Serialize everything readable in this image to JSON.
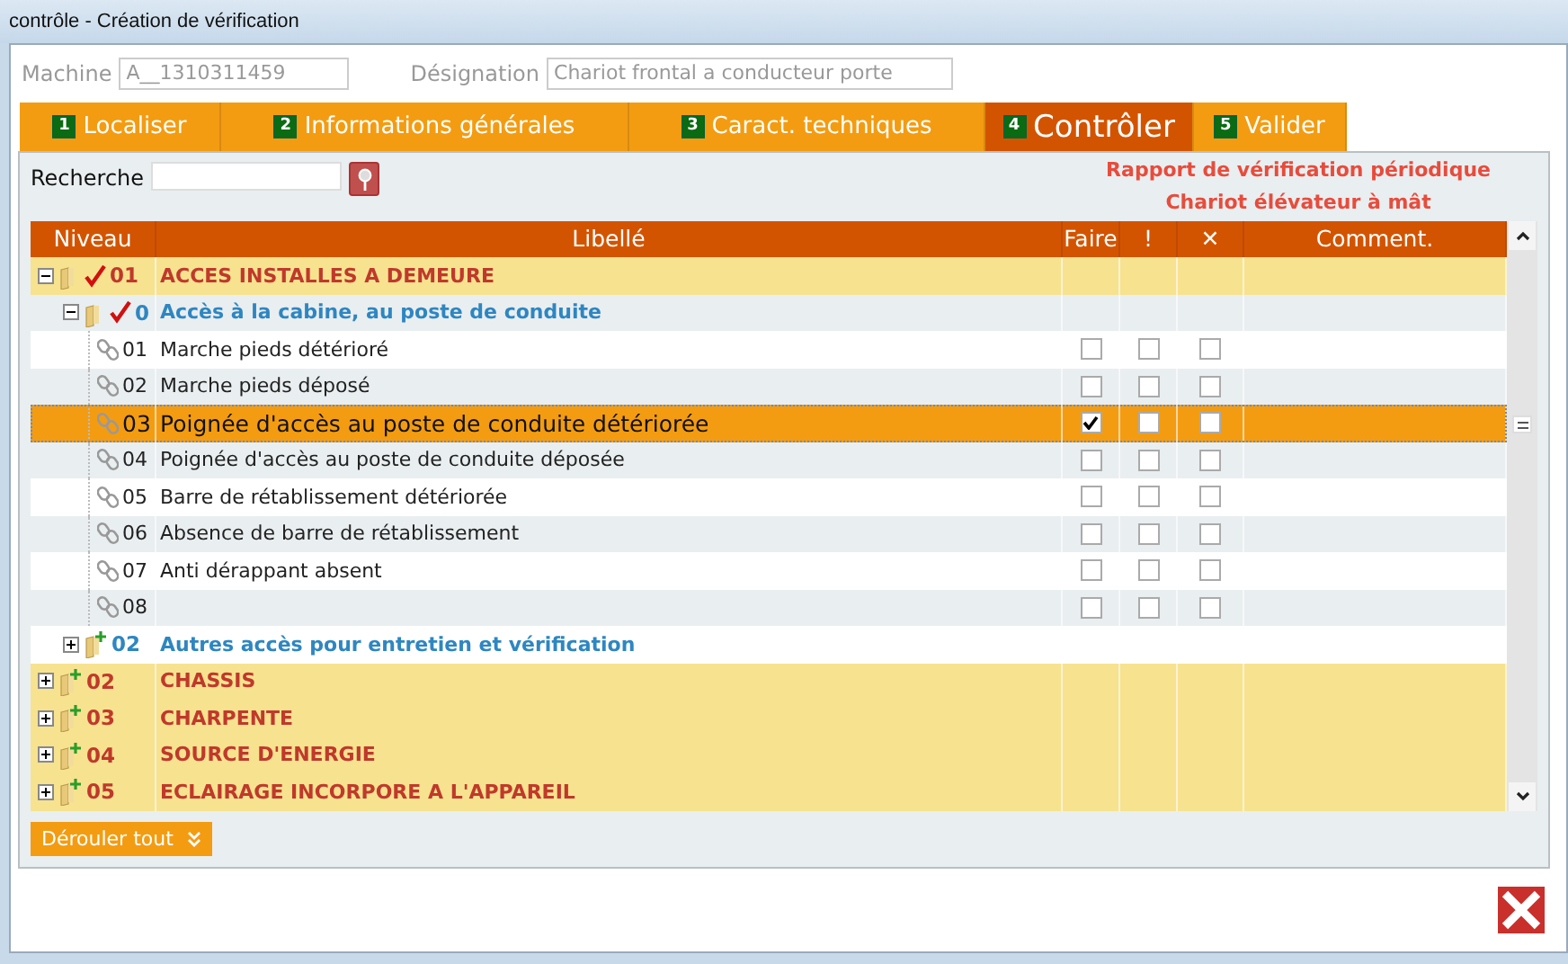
{
  "window": {
    "title": "contrôle - Création de vérification"
  },
  "header": {
    "machine_label": "Machine",
    "machine_value": "A__1310311459",
    "designation_label": "Désignation",
    "designation_value": "Chariot frontal a conducteur porte"
  },
  "tabs": [
    {
      "number": "1",
      "label": "Localiser",
      "selected": false
    },
    {
      "number": "2",
      "label": "Informations générales",
      "selected": false
    },
    {
      "number": "3",
      "label": "Caract. techniques",
      "selected": false
    },
    {
      "number": "4",
      "label": "Contrôler",
      "selected": true
    },
    {
      "number": "5",
      "label": "Valider",
      "selected": false
    }
  ],
  "search": {
    "label": "Recherche"
  },
  "report": {
    "title": "Rapport de vérification périodique",
    "subtitle": "Chariot élévateur à mât"
  },
  "table": {
    "columns": [
      "Niveau",
      "Libellé",
      "Faire",
      "!",
      "✕",
      "Comment."
    ],
    "rows": [
      {
        "number": "01",
        "label": "ACCES INSTALLES A DEMEURE",
        "expanded": true,
        "checked": true,
        "children": [
          {
            "number": "0",
            "label": "Accès à la cabine, au poste de conduite",
            "expanded": true,
            "checked": true,
            "children": [
              {
                "number": "01",
                "label": "Marche pieds détérioré",
                "faire": false,
                "warning": false,
                "cross": false,
                "selected": false
              },
              {
                "number": "02",
                "label": "Marche pieds déposé",
                "faire": false,
                "warning": false,
                "cross": false,
                "selected": false
              },
              {
                "number": "03",
                "label": "Poignée d'accès au poste de conduite détériorée",
                "faire": true,
                "warning": false,
                "cross": false,
                "selected": true
              },
              {
                "number": "04",
                "label": "Poignée d'accès au poste de conduite déposée",
                "faire": false,
                "warning": false,
                "cross": false,
                "selected": false
              },
              {
                "number": "05",
                "label": "Barre de rétablissement détériorée",
                "faire": false,
                "warning": false,
                "cross": false,
                "selected": false
              },
              {
                "number": "06",
                "label": "Absence de barre de rétablissement",
                "faire": false,
                "warning": false,
                "cross": false,
                "selected": false
              },
              {
                "number": "07",
                "label": "Anti dérappant absent",
                "faire": false,
                "warning": false,
                "cross": false,
                "selected": false
              },
              {
                "number": "08",
                "faire": false,
                "warning": false,
                "cross": false,
                "selected": false
              }
            ]
          },
          {
            "number": "02",
            "label": "Autres accès pour entretien et vérification",
            "expanded": false,
            "checked": false
          }
        ]
      },
      {
        "number": "02",
        "label": "CHASSIS",
        "expanded": false,
        "checked": false
      },
      {
        "number": "03",
        "label": "CHARPENTE",
        "expanded": false,
        "checked": false
      },
      {
        "number": "04",
        "label": "SOURCE D'ENERGIE",
        "expanded": false,
        "checked": false
      },
      {
        "number": "05",
        "label": "ECLAIRAGE INCORPORE A L'APPAREIL",
        "expanded": false,
        "checked": false
      }
    ]
  },
  "expand_all_button": "Dérouler tout"
}
